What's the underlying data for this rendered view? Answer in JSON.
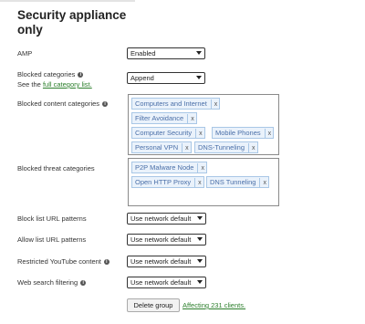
{
  "section": {
    "title": "Security appliance only"
  },
  "amp": {
    "label": "AMP",
    "value": "Enabled"
  },
  "blocked_categories": {
    "label": "Blocked categories",
    "see_text": "See the",
    "link": "full category list.",
    "value": "Append"
  },
  "blocked_content": {
    "label": "Blocked content categories",
    "tags": [
      "Computers and Internet",
      "Filter Avoidance",
      "Computer Security",
      "Mobile Phones",
      "Personal VPN",
      "DNS-Tunneling"
    ]
  },
  "blocked_threat": {
    "label": "Blocked threat categories",
    "tags": [
      "P2P Malware Node",
      "Open HTTP Proxy",
      "DNS Tunneling"
    ]
  },
  "block_list": {
    "label": "Block list URL patterns",
    "value": "Use network default"
  },
  "allow_list": {
    "label": "Allow list URL patterns",
    "value": "Use network default"
  },
  "youtube": {
    "label": "Restricted YouTube content",
    "value": "Use network default"
  },
  "web_search": {
    "label": "Web search filtering",
    "value": "Use network default"
  },
  "tag_remove_glyph": "x",
  "info_glyph": "i",
  "footer": {
    "delete_button": "Delete group",
    "affecting": "Affecting 231 clients."
  }
}
